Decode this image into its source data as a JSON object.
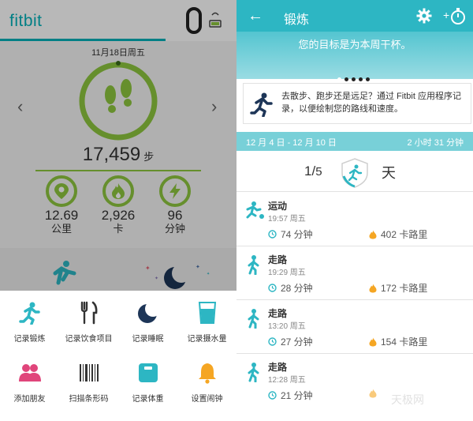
{
  "left": {
    "logo": "fitbit",
    "date": "11月18日周五",
    "steps": {
      "value": "17,459",
      "unit": "步"
    },
    "stats": [
      {
        "icon": "location-pin-icon",
        "value": "12.69",
        "unit": "公里"
      },
      {
        "icon": "flame-icon",
        "value": "2,926",
        "unit": "卡"
      },
      {
        "icon": "lightning-icon",
        "value": "96",
        "unit": "分钟"
      }
    ],
    "quick_actions": [
      {
        "icon": "runner-icon",
        "label": "记录锻炼"
      },
      {
        "icon": "fork-knife-icon",
        "label": "记录饮食项目"
      },
      {
        "icon": "moon-icon",
        "label": "记录睡眠"
      },
      {
        "icon": "water-glass-icon",
        "label": "记录摄水量"
      },
      {
        "icon": "friends-icon",
        "label": "添加朋友"
      },
      {
        "icon": "barcode-icon",
        "label": "扫描条形码"
      },
      {
        "icon": "scale-icon",
        "label": "记录体重"
      },
      {
        "icon": "bell-icon",
        "label": "设置闹钟"
      }
    ]
  },
  "right": {
    "title": "锻炼",
    "goal_text": "您的目标是为本周干杯。",
    "tip_text": "去散步、跑步还是远足？通过 Fitbit 应用程序记录，以便绘制您的路线和速度。",
    "week_range": "12 月 4 日 - 12 月 10 日",
    "week_total": "2 小时 31 分钟",
    "progress": {
      "done": "1",
      "total": "5",
      "unit": "天"
    },
    "activities": [
      {
        "icon": "soccer-icon",
        "name": "运动",
        "time": "19:57 周五",
        "duration": "74 分钟",
        "calories": "402 卡路里"
      },
      {
        "icon": "walk-icon",
        "name": "走路",
        "time": "19:29 周五",
        "duration": "28 分钟",
        "calories": "172 卡路里"
      },
      {
        "icon": "walk-icon",
        "name": "走路",
        "time": "13:20 周五",
        "duration": "27 分钟",
        "calories": "154 卡路里"
      },
      {
        "icon": "walk-icon",
        "name": "走路",
        "time": "12:28 周五",
        "duration": "21 分钟",
        "calories": ""
      }
    ],
    "watermark": "天极网"
  },
  "colors": {
    "teal": "#2db6c3",
    "green": "#8ec63f",
    "orange": "#f5a623",
    "navy": "#1d3557"
  }
}
